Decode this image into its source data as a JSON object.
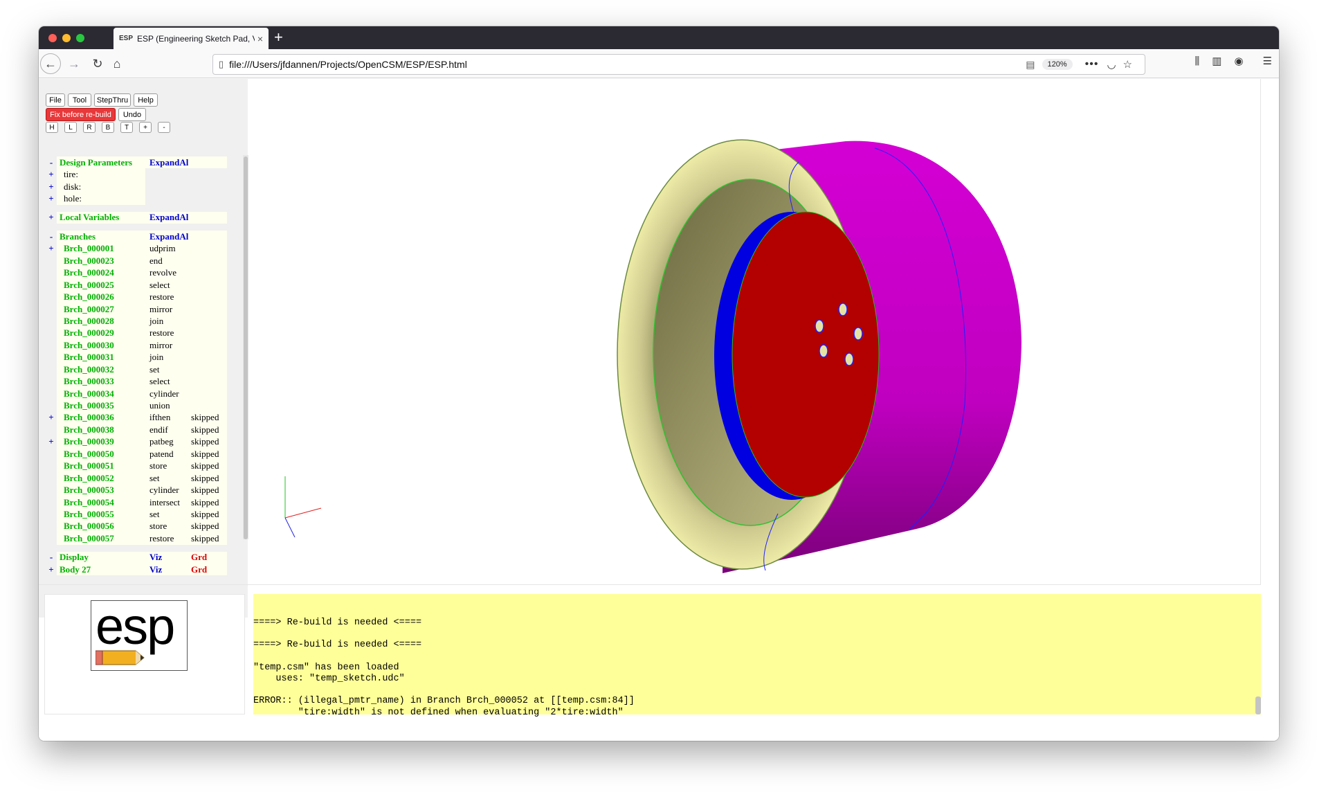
{
  "browser": {
    "tab_favicon": "ESP",
    "tab_title": "ESP (Engineering Sketch Pad, V",
    "tab_close": "×",
    "new_tab": "+",
    "url": "file:///Users/jfdannen/Projects/OpenCSM/ESP/ESP.html",
    "zoom": "120%",
    "icons": {
      "back": "arrow-left-icon",
      "forward": "arrow-right-icon",
      "reload": "reload-icon",
      "home": "home-icon",
      "page": "page-icon",
      "reader": "reader-view-icon",
      "more": "more-icon",
      "pocket": "pocket-icon",
      "star": "star-icon",
      "library": "library-icon",
      "sidebar": "sidebar-icon",
      "account": "account-icon",
      "menu": "hamburger-menu-icon"
    }
  },
  "toolbar": {
    "file": "File",
    "tool": "Tool",
    "stepthru": "StepThru",
    "help": "Help",
    "fix": "Fix before re-build",
    "undo": "Undo",
    "views": [
      "H",
      "L",
      "R",
      "B",
      "T",
      "+",
      "-"
    ]
  },
  "tree": {
    "design": {
      "toggle": "-",
      "label": "Design Parameters",
      "action": "ExpandAll"
    },
    "params": [
      {
        "toggle": "+",
        "label": "tire:"
      },
      {
        "toggle": "+",
        "label": "disk:"
      },
      {
        "toggle": "+",
        "label": "hole:"
      }
    ],
    "local": {
      "toggle": "+",
      "label": "Local Variables",
      "action": "ExpandAll"
    },
    "branches_header": {
      "toggle": "-",
      "label": "Branches",
      "action": "ExpandAll"
    },
    "branches": [
      {
        "toggle": "+",
        "name": "Brch_000001",
        "type": "udprim",
        "status": ""
      },
      {
        "toggle": "",
        "name": "Brch_000023",
        "type": "end",
        "status": ""
      },
      {
        "toggle": "",
        "name": "Brch_000024",
        "type": "revolve",
        "status": ""
      },
      {
        "toggle": "",
        "name": "Brch_000025",
        "type": "select",
        "status": ""
      },
      {
        "toggle": "",
        "name": "Brch_000026",
        "type": "restore",
        "status": ""
      },
      {
        "toggle": "",
        "name": "Brch_000027",
        "type": "mirror",
        "status": ""
      },
      {
        "toggle": "",
        "name": "Brch_000028",
        "type": "join",
        "status": ""
      },
      {
        "toggle": "",
        "name": "Brch_000029",
        "type": "restore",
        "status": ""
      },
      {
        "toggle": "",
        "name": "Brch_000030",
        "type": "mirror",
        "status": ""
      },
      {
        "toggle": "",
        "name": "Brch_000031",
        "type": "join",
        "status": ""
      },
      {
        "toggle": "",
        "name": "Brch_000032",
        "type": "set",
        "status": ""
      },
      {
        "toggle": "",
        "name": "Brch_000033",
        "type": "select",
        "status": ""
      },
      {
        "toggle": "",
        "name": "Brch_000034",
        "type": "cylinder",
        "status": ""
      },
      {
        "toggle": "",
        "name": "Brch_000035",
        "type": "union",
        "status": ""
      },
      {
        "toggle": "+",
        "name": "Brch_000036",
        "type": "ifthen",
        "status": "skipped"
      },
      {
        "toggle": "",
        "name": "Brch_000038",
        "type": "endif",
        "status": "skipped"
      },
      {
        "toggle": "+",
        "name": "Brch_000039",
        "type": "patbeg",
        "status": "skipped"
      },
      {
        "toggle": "",
        "name": "Brch_000050",
        "type": "patend",
        "status": "skipped"
      },
      {
        "toggle": "",
        "name": "Brch_000051",
        "type": "store",
        "status": "skipped"
      },
      {
        "toggle": "",
        "name": "Brch_000052",
        "type": "set",
        "status": "skipped"
      },
      {
        "toggle": "",
        "name": "Brch_000053",
        "type": "cylinder",
        "status": "skipped"
      },
      {
        "toggle": "",
        "name": "Brch_000054",
        "type": "intersect",
        "status": "skipped"
      },
      {
        "toggle": "",
        "name": "Brch_000055",
        "type": "set",
        "status": "skipped"
      },
      {
        "toggle": "",
        "name": "Brch_000056",
        "type": "store",
        "status": "skipped"
      },
      {
        "toggle": "",
        "name": "Brch_000057",
        "type": "restore",
        "status": "skipped"
      }
    ],
    "display": {
      "toggle": "-",
      "label": "Display",
      "viz": "Viz",
      "grd": "Grd"
    },
    "body": {
      "toggle": "+",
      "label": "Body 27",
      "viz": "Viz",
      "grd": "Grd"
    }
  },
  "logo": {
    "text": "esp"
  },
  "messages": [
    "====> Re-build is needed <====",
    "",
    "====> Re-build is needed <====",
    "",
    "\"temp.csm\" has been loaded",
    "    uses: \"temp_sketch.udc\"",
    "",
    "ERROR:: (illegal_pmtr_name) in Branch Brch_000052 at [[temp.csm:84]]",
    "        \"tire:width\" is not defined when evaluating \"2*tire:width\""
  ],
  "colors": {
    "tire_face": "#d7d49a",
    "tire_tread": "#c400c4",
    "rim": "#b30000",
    "rim_lip": "#0000e0",
    "message_bg": "#ffff99",
    "tree_green": "#00b000",
    "tree_blue": "#0000cc",
    "fix_button": "#e8383a"
  }
}
